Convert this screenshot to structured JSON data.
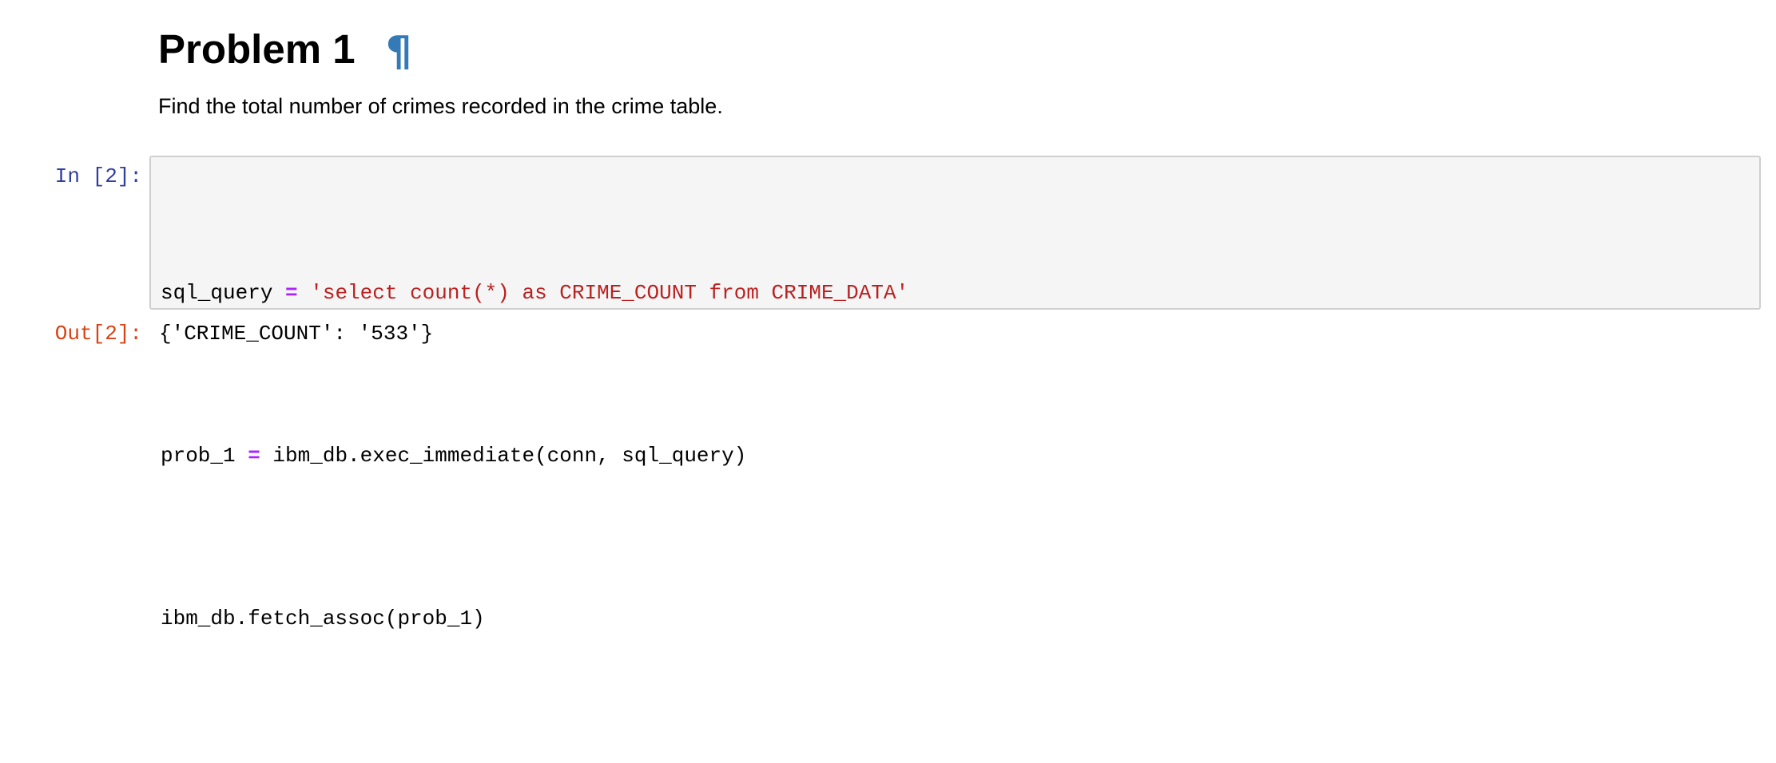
{
  "markdown": {
    "heading": "Problem 1",
    "anchor_symbol": "¶",
    "description": "Find the total number of crimes recorded in the crime table."
  },
  "code_cell": {
    "in_prompt": "In [2]:",
    "line1": {
      "var": "sql_query ",
      "op": "=",
      "string": " 'select count(*) as CRIME_COUNT from CRIME_DATA'"
    },
    "line2": {
      "var": "prob_1 ",
      "op": "=",
      "rest": " ibm_db.exec_immediate(conn, sql_query)"
    },
    "line3": "ibm_db.fetch_assoc(prob_1)",
    "out_prompt": "Out[2]:",
    "output": "{'CRIME_COUNT': '533'}"
  },
  "colors": {
    "in_prompt": "#303f9f",
    "out_prompt": "#d84315",
    "anchor": "#337ab7",
    "operator": "#aa22ff",
    "string": "#ba2121",
    "cell_background": "#f5f5f5"
  }
}
